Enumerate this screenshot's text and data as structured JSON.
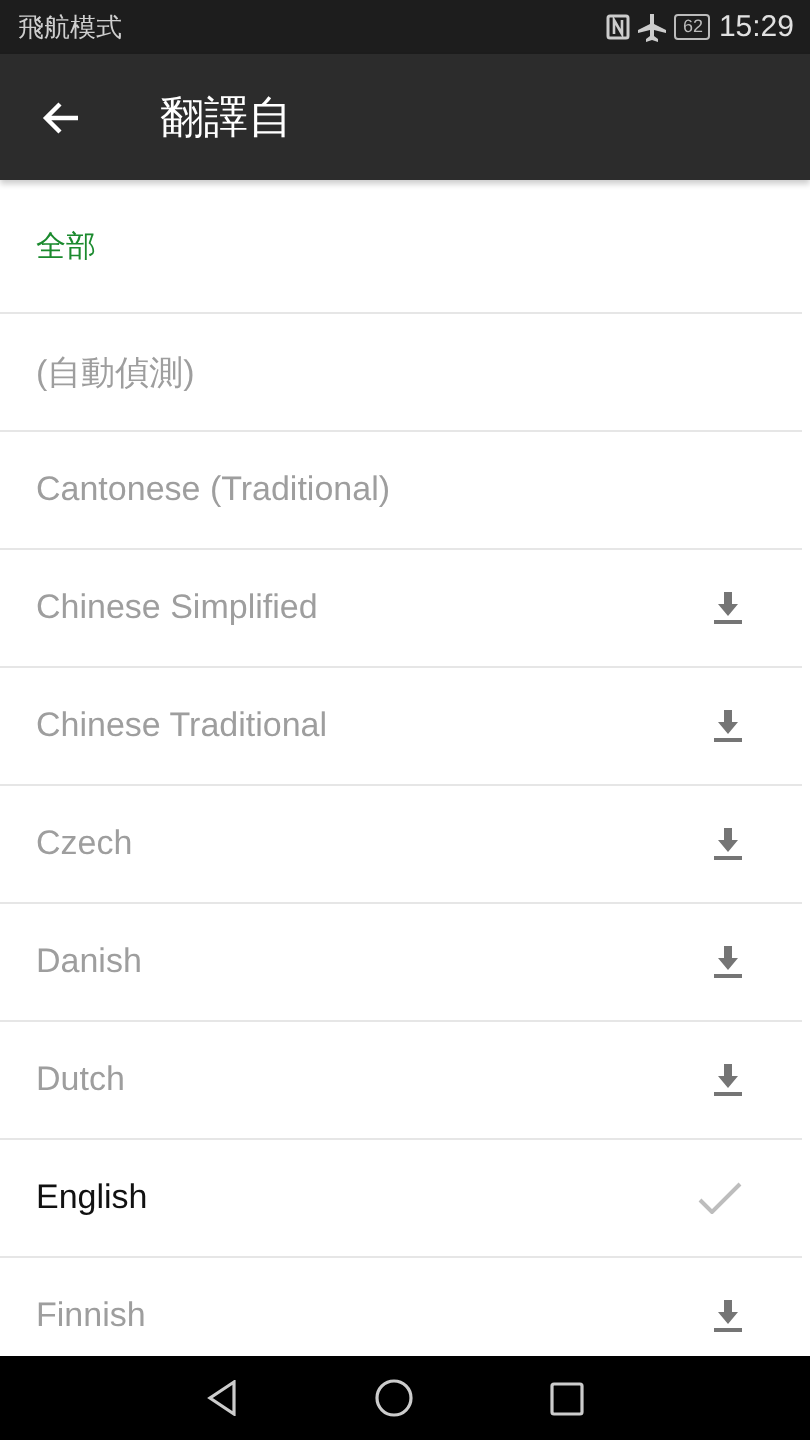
{
  "status_bar": {
    "mode": "飛航模式",
    "battery": "62",
    "time": "15:29"
  },
  "app_bar": {
    "title": "翻譯自"
  },
  "section_header": "全部",
  "languages": [
    {
      "label": "(自動偵測)",
      "kind": "plain",
      "selected": false
    },
    {
      "label": "Cantonese (Traditional)",
      "kind": "plain",
      "selected": false
    },
    {
      "label": "Chinese Simplified",
      "kind": "download",
      "selected": false
    },
    {
      "label": "Chinese Traditional",
      "kind": "download",
      "selected": false
    },
    {
      "label": "Czech",
      "kind": "download",
      "selected": false
    },
    {
      "label": "Danish",
      "kind": "download",
      "selected": false
    },
    {
      "label": "Dutch",
      "kind": "download",
      "selected": false
    },
    {
      "label": "English",
      "kind": "installed",
      "selected": true
    },
    {
      "label": "Finnish",
      "kind": "download",
      "selected": false
    }
  ]
}
